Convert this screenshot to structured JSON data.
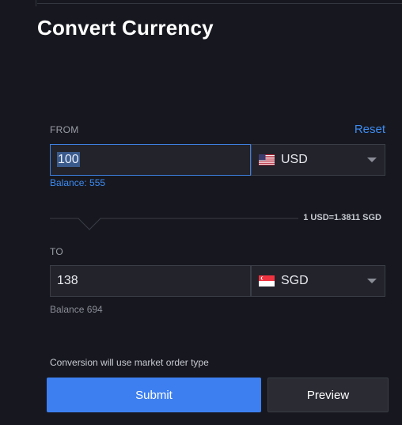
{
  "page": {
    "title": "Convert Currency"
  },
  "from": {
    "label": "FROM",
    "reset_label": "Reset",
    "amount": "100",
    "currency": "USD",
    "flag_icon": "us-flag-icon",
    "balance": "Balance: 555"
  },
  "rate": {
    "text": "1 USD=1.3811 SGD"
  },
  "to": {
    "label": "TO",
    "amount": "138",
    "currency": "SGD",
    "flag_icon": "sg-flag-icon",
    "balance": "Balance 694"
  },
  "note": "Conversion will use market order type",
  "actions": {
    "submit_label": "Submit",
    "preview_label": "Preview"
  },
  "colors": {
    "background": "#17181f",
    "accent": "#3d7ff0",
    "link": "#3d8bf2",
    "field_bg": "#22232b"
  }
}
